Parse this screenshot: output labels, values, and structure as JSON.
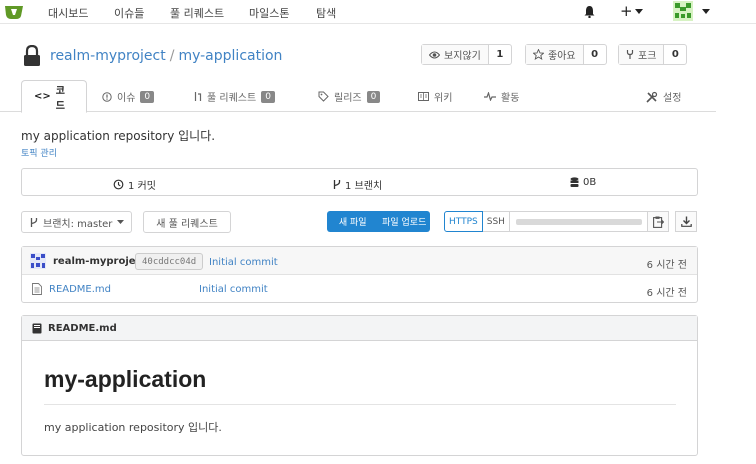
{
  "topnav": {
    "items": [
      "대시보드",
      "이슈들",
      "풀 리퀘스트",
      "마일스톤",
      "탐색"
    ],
    "plus": "+"
  },
  "repo": {
    "owner": "realm-myproject",
    "separator": "/",
    "name": "my-application",
    "watch": {
      "label": "보지않기",
      "count": "1"
    },
    "star": {
      "label": "좋아요",
      "count": "0"
    },
    "fork": {
      "label": "포크",
      "count": "0"
    }
  },
  "tabs": {
    "code": "코드",
    "issues": "이슈",
    "issues_count": "0",
    "pulls": "풀 리퀘스트",
    "pulls_count": "0",
    "releases": "릴리즈",
    "releases_count": "0",
    "wiki": "위키",
    "activity": "활동",
    "settings": "설정"
  },
  "description": "my application repository 입니다.",
  "topics_link": "토픽 관리",
  "stats": {
    "commits": "1 커밋",
    "branches": "1 브랜치",
    "size": "0B"
  },
  "toolbar": {
    "branch": "브랜치: master",
    "new_pr": "새 풀 리퀘스트",
    "new_file": "새 파일",
    "upload_file": "파일 업로드",
    "https": "HTTPS",
    "ssh": "SSH"
  },
  "latest_commit": {
    "author": "realm-myproject",
    "sha": "40cddcc04d",
    "message": "Initial commit",
    "time": "6 시간 전"
  },
  "files": [
    {
      "name": "README.md",
      "commit": "Initial commit",
      "time": "6 시간 전"
    }
  ],
  "readme": {
    "filename": "README.md",
    "heading": "my-application",
    "body": "my application repository 입니다."
  },
  "colors": {
    "accent": "#2185d0",
    "link": "#4183c4",
    "logo": "#609926"
  }
}
